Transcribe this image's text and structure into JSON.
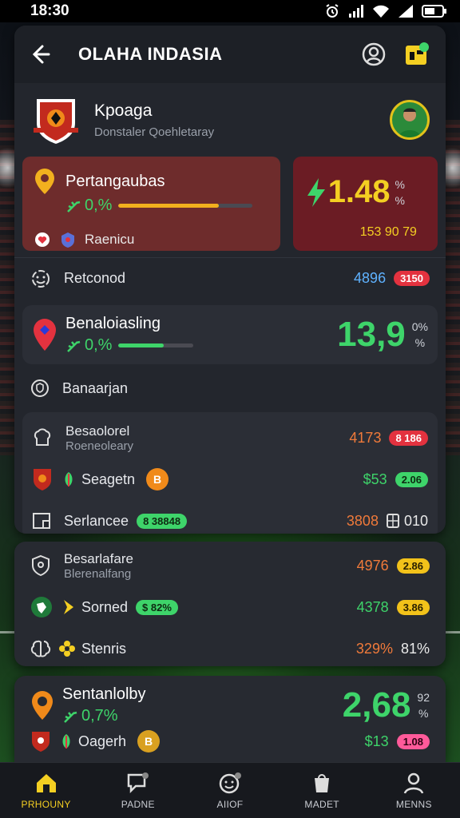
{
  "status": {
    "time": "18:30"
  },
  "app": {
    "title": "OLAHA INDASIA"
  },
  "profile": {
    "name": "Kpoaga",
    "subtitle": "Donstaler Qoehletaray"
  },
  "stat_main": {
    "title": "Pertangaubas",
    "pct": "0,%",
    "progress": 0.75,
    "sub_label": "Raenicu"
  },
  "stat_side": {
    "value": "1.48",
    "unit_top": "%",
    "unit_bottom": "%",
    "footer": "153 90 79"
  },
  "row_retconod": {
    "label": "Retconod",
    "value": "4896",
    "pill": "3150"
  },
  "stat_second": {
    "title": "Benaloiasling",
    "pct": "0,%",
    "progress": 0.6,
    "value": "13,9",
    "unit_top": "0%",
    "unit_bottom": "%"
  },
  "row_banaarjan": {
    "label": "Banaarjan"
  },
  "sec1": {
    "rows": [
      {
        "line1": "Besaolorel",
        "line2": "Roeneoleary",
        "value": "4173",
        "pill": "8 186"
      },
      {
        "line1": "Seagetn",
        "badge": "B",
        "value": "$53",
        "pill": "2.06"
      },
      {
        "line1": "Serlancee",
        "chip": "8 38848",
        "value": "3808",
        "value2": "010"
      }
    ]
  },
  "sec2": {
    "rows": [
      {
        "line1": "Besarlafare",
        "line2": "Blerenalfang",
        "value": "4976",
        "pill": "2.86"
      },
      {
        "line1": "Sorned",
        "chip": "$ 82%",
        "value": "4378",
        "pill": "3.86"
      },
      {
        "line1": "Stenris",
        "value": "329%",
        "value2": "81%"
      }
    ]
  },
  "sec3": {
    "title": "Sentanlolby",
    "pct": "0,7%",
    "value": "2,68",
    "unit_top": "92",
    "unit_bottom": "%",
    "row_label": "Oagerh",
    "badge": "B",
    "row_value": "$13",
    "row_pill": "1.08"
  },
  "nav": [
    {
      "label": "PRHOUNY",
      "icon": "home-icon"
    },
    {
      "label": "PADNE",
      "icon": "chat-icon"
    },
    {
      "label": "AIIOF",
      "icon": "smiley-icon"
    },
    {
      "label": "MADET",
      "icon": "bag-icon"
    },
    {
      "label": "MENNS",
      "icon": "person-icon"
    }
  ],
  "colors": {
    "accent": "#f4cf22",
    "positive": "#3ed46a",
    "negative": "#e3323f",
    "card_red": "#6e2c2c"
  }
}
